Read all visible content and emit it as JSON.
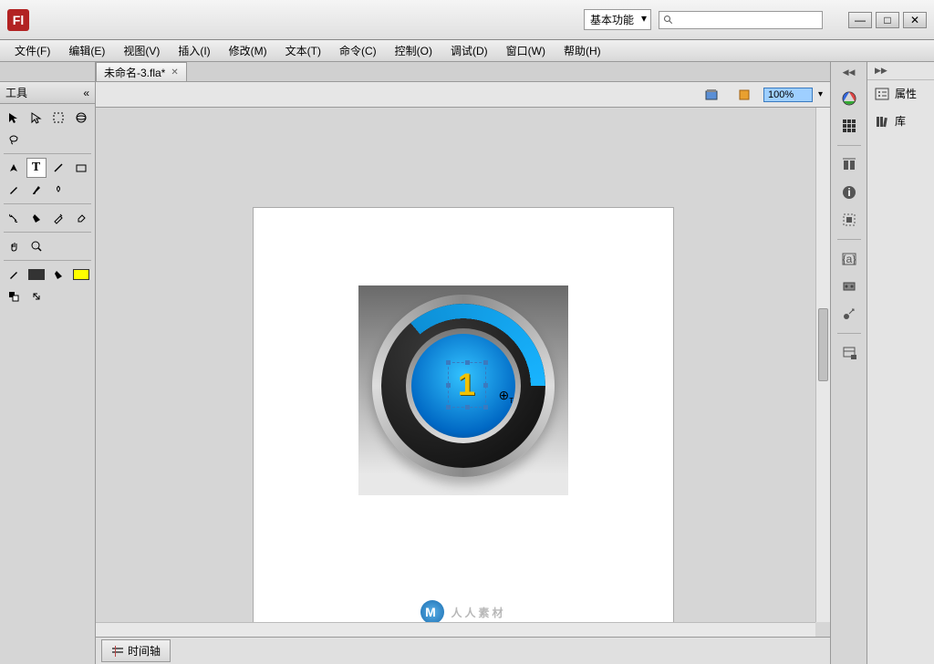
{
  "app": {
    "logo": "Fl"
  },
  "titlebar": {
    "workspace": "基本功能",
    "search_placeholder": ""
  },
  "menu": {
    "items": [
      "文件(F)",
      "编辑(E)",
      "视图(V)",
      "插入(I)",
      "修改(M)",
      "文本(T)",
      "命令(C)",
      "控制(O)",
      "调试(D)",
      "窗口(W)",
      "帮助(H)"
    ]
  },
  "document": {
    "tab_name": "未命名-3.fla*",
    "zoom": "100%"
  },
  "tools": {
    "panel_title": "工具",
    "stroke_color": "#333333",
    "fill_color": "#ffff00"
  },
  "canvas": {
    "text_value": "1"
  },
  "timeline": {
    "label": "时间轴"
  },
  "right_tabs": {
    "properties": "属性",
    "library": "库"
  },
  "watermark": {
    "text": "人人素材"
  }
}
